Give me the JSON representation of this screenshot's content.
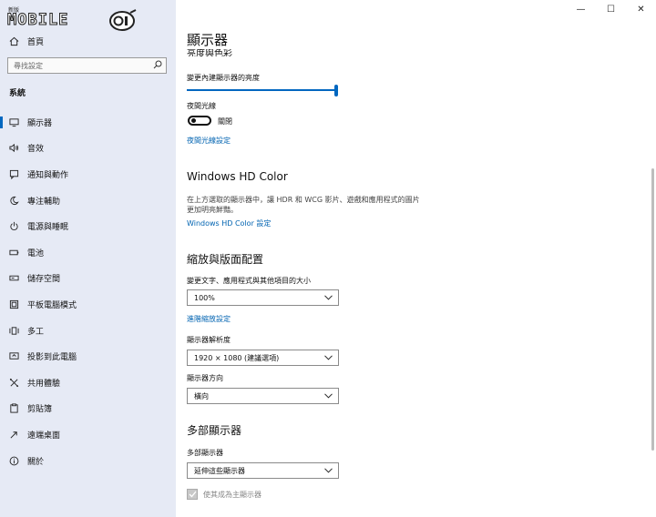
{
  "sidebar": {
    "logo_small": "新版",
    "logo_word": "MOBILE",
    "logo_badge": "01",
    "home_label": "首頁",
    "search_placeholder": "尋找設定",
    "section_title": "系統",
    "items": [
      {
        "label": "顯示器",
        "icon": "monitor-icon",
        "active": true
      },
      {
        "label": "音效",
        "icon": "speaker-icon"
      },
      {
        "label": "通知與動作",
        "icon": "notification-icon"
      },
      {
        "label": "專注輔助",
        "icon": "moon-icon"
      },
      {
        "label": "電源與睡眠",
        "icon": "power-icon"
      },
      {
        "label": "電池",
        "icon": "battery-icon"
      },
      {
        "label": "儲存空間",
        "icon": "storage-icon"
      },
      {
        "label": "平板電腦模式",
        "icon": "tablet-icon"
      },
      {
        "label": "多工",
        "icon": "multitask-icon"
      },
      {
        "label": "投影到此電腦",
        "icon": "project-icon"
      },
      {
        "label": "共用體驗",
        "icon": "shared-icon"
      },
      {
        "label": "剪貼簿",
        "icon": "clipboard-icon"
      },
      {
        "label": "遠端桌面",
        "icon": "remote-icon"
      },
      {
        "label": "關於",
        "icon": "info-icon"
      }
    ]
  },
  "window": {
    "minimize": "—",
    "maximize": "☐",
    "close": "✕"
  },
  "content": {
    "title": "顯示器",
    "clipped_heading": "亮度與色彩",
    "brightness_label": "變更內建顯示器的亮度",
    "brightness_value": 1.0,
    "night_light_label": "夜間光線",
    "night_light_state": "關閉",
    "night_light_link": "夜間光線設定",
    "hd_title": "Windows HD Color",
    "hd_desc_line1": "在上方選取的顯示器中，讓 HDR 和 WCG 影片、遊戲和應用程式的圖片",
    "hd_desc_line2": "更加明亮鮮豔。",
    "hd_link": "Windows HD Color 設定",
    "scale_title": "縮放與版面配置",
    "scale_label": "變更文字、應用程式與其他項目的大小",
    "scale_value": "100%",
    "scale_link": "進階縮放設定",
    "resolution_label": "顯示器解析度",
    "resolution_value": "1920 × 1080 (建議選項)",
    "orientation_label": "顯示器方向",
    "orientation_value": "橫向",
    "multi_title": "多部顯示器",
    "multi_label": "多部顯示器",
    "multi_value": "延伸這些顯示器",
    "main_display_label": "使其成為主顯示器"
  },
  "colors": {
    "accent": "#0067c0",
    "link": "#0063b1",
    "sidebar_bg": "#e6eaf5"
  }
}
